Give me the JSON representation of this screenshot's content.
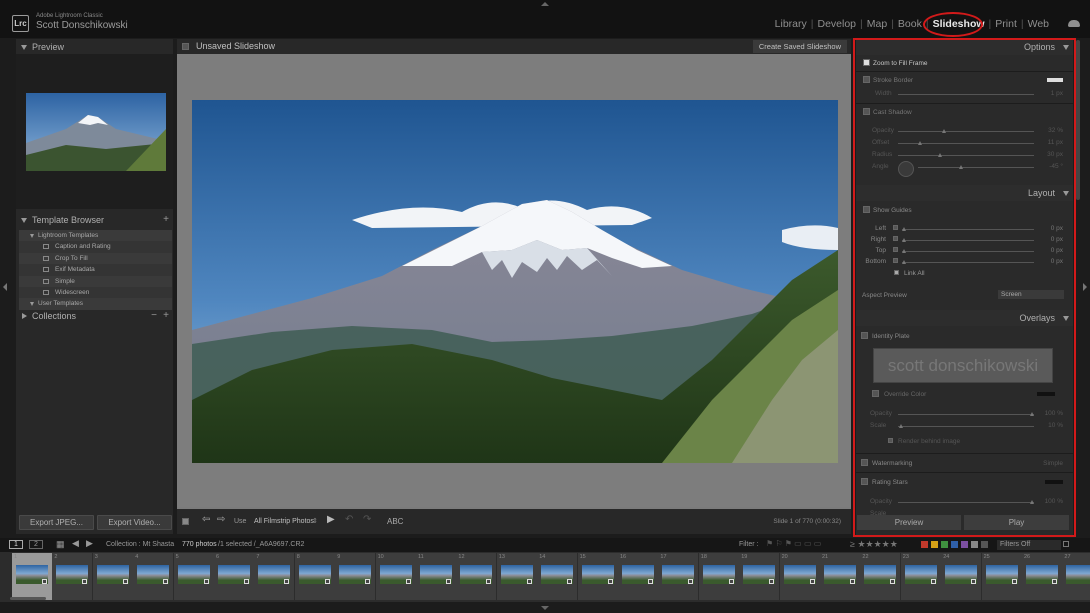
{
  "app": {
    "product": "Adobe Lightroom Classic",
    "user": "Scott Donschikowski",
    "logo": "Lrc"
  },
  "modules": [
    "Library",
    "Develop",
    "Map",
    "Book",
    "Slideshow",
    "Print",
    "Web"
  ],
  "active_module": "Slideshow",
  "left_panel": {
    "preview_label": "Preview",
    "template_browser_label": "Template Browser",
    "lightroom_templates": "Lightroom Templates",
    "templates": [
      "Caption and Rating",
      "Crop To Fill",
      "Exif Metadata",
      "Simple",
      "Widescreen"
    ],
    "user_templates": "User Templates",
    "collections_label": "Collections",
    "export_jpeg": "Export JPEG...",
    "export_video": "Export Video..."
  },
  "center": {
    "title": "Unsaved Slideshow",
    "create_saved": "Create Saved Slideshow",
    "use_label": "Use",
    "use_value": "All Filmstrip Photos",
    "text_tool": "ABC",
    "slide_counter": "Slide 1 of 770 (0:00:32)"
  },
  "right_panel": {
    "options_label": "Options",
    "zoom_to_fill": "Zoom to Fill Frame",
    "stroke_border": "Stroke Border",
    "width_label": "Width",
    "width_value": "1 px",
    "cast_shadow": "Cast Shadow",
    "shadow_rows": [
      {
        "label": "Opacity",
        "value": "32 %"
      },
      {
        "label": "Offset",
        "value": "11 px"
      },
      {
        "label": "Radius",
        "value": "30 px"
      },
      {
        "label": "Angle",
        "value": "-45 °"
      }
    ],
    "layout_label": "Layout",
    "show_guides": "Show Guides",
    "guide_rows": [
      {
        "label": "Left",
        "value": "0 px"
      },
      {
        "label": "Right",
        "value": "0 px"
      },
      {
        "label": "Top",
        "value": "0 px"
      },
      {
        "label": "Bottom",
        "value": "0 px"
      }
    ],
    "link_all": "Link All",
    "aspect_preview_label": "Aspect Preview",
    "aspect_preview_value": "Screen",
    "overlays_label": "Overlays",
    "identity_plate": "Identity Plate",
    "identity_plate_text": "scott donschikowski",
    "override_color": "Override Color",
    "overlay_rows": [
      {
        "label": "Opacity",
        "value": "100 %"
      },
      {
        "label": "Scale",
        "value": "10 %"
      }
    ],
    "render_behind": "Render behind image",
    "watermarking": "Watermarking",
    "watermark_value": "Simple",
    "rating_stars": "Rating Stars",
    "rating_rows": [
      {
        "label": "Opacity",
        "value": "100 %"
      },
      {
        "label": "Scale",
        "value": ""
      }
    ],
    "preview_btn": "Preview",
    "play_btn": "Play"
  },
  "filmstrip": {
    "screen1": "1",
    "screen2": "2",
    "collection": "Collection : Mt Shasta",
    "count": "770 photos",
    "selection": "/1 selected /_A6A9697.CR2",
    "filter_label": "Filter :",
    "filters_off": "Filters Off",
    "cell_numbers": [
      "1",
      "2",
      "3",
      "4",
      "5",
      "6",
      "7",
      "8",
      "9",
      "10",
      "11",
      "12",
      "13",
      "14",
      "15",
      "16",
      "17",
      "18",
      "19",
      "20",
      "21",
      "22",
      "23",
      "24",
      "25",
      "26",
      "27"
    ],
    "label_colors": [
      "#c0392b",
      "#d4a017",
      "#3f8f3f",
      "#2f5fa8",
      "#7b4fa0",
      "#888888",
      "#555555"
    ]
  }
}
